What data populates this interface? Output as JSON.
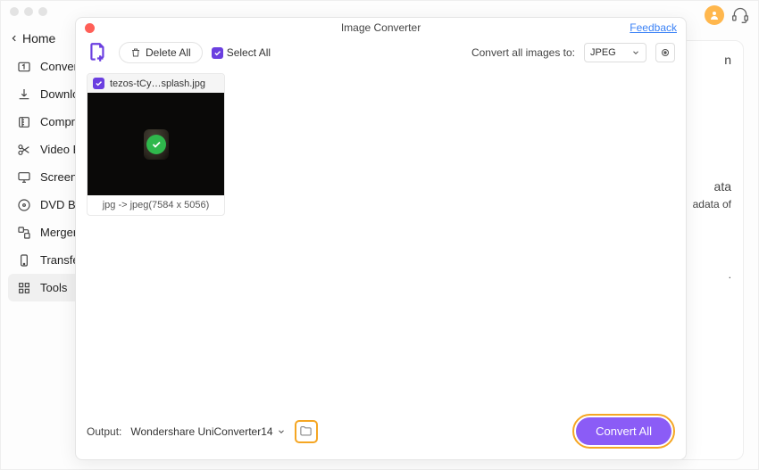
{
  "header": {
    "home": "Home"
  },
  "sidebar": {
    "items": [
      {
        "label": "Converter"
      },
      {
        "label": "Downloader"
      },
      {
        "label": "Compressor"
      },
      {
        "label": "Video Editor"
      },
      {
        "label": "Screen Recorder"
      },
      {
        "label": "DVD Burner"
      },
      {
        "label": "Merger"
      },
      {
        "label": "Transfer"
      },
      {
        "label": "Tools"
      }
    ]
  },
  "background": {
    "line1": "n",
    "heading": "ata",
    "sub1": "adata of",
    "sub2": "."
  },
  "modal": {
    "title": "Image Converter",
    "feedback": "Feedback",
    "delete_all": "Delete All",
    "select_all": "Select All",
    "convert_label": "Convert all images to:",
    "format": "JPEG",
    "file": {
      "name": "tezos-tCy…splash.jpg",
      "info": "jpg -> jpeg(7584 x 5056)"
    },
    "output_label": "Output:",
    "output_path": "Wondershare UniConverter14",
    "convert_button": "Convert All"
  }
}
